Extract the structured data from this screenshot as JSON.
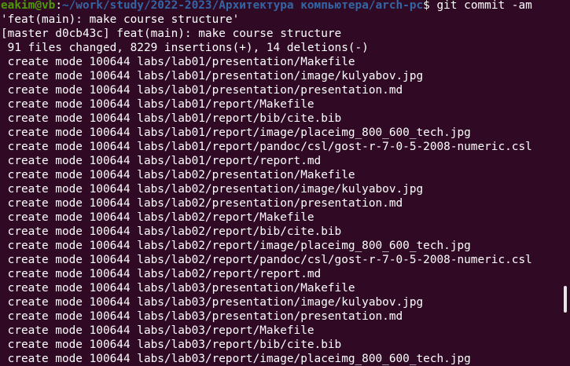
{
  "prompt": {
    "user_host": "eakim@vb",
    "separator": ":",
    "path": "~/work/study/2022-2023/Архитектура компьютера/arch-pc",
    "symbol": "$",
    "command": " git commit -am"
  },
  "output": [
    "'feat(main): make course structure'",
    "[master d0cb43c] feat(main): make course structure",
    " 91 files changed, 8229 insertions(+), 14 deletions(-)",
    " create mode 100644 labs/lab01/presentation/Makefile",
    " create mode 100644 labs/lab01/presentation/image/kulyabov.jpg",
    " create mode 100644 labs/lab01/presentation/presentation.md",
    " create mode 100644 labs/lab01/report/Makefile",
    " create mode 100644 labs/lab01/report/bib/cite.bib",
    " create mode 100644 labs/lab01/report/image/placeimg_800_600_tech.jpg",
    " create mode 100644 labs/lab01/report/pandoc/csl/gost-r-7-0-5-2008-numeric.csl",
    " create mode 100644 labs/lab01/report/report.md",
    " create mode 100644 labs/lab02/presentation/Makefile",
    " create mode 100644 labs/lab02/presentation/image/kulyabov.jpg",
    " create mode 100644 labs/lab02/presentation/presentation.md",
    " create mode 100644 labs/lab02/report/Makefile",
    " create mode 100644 labs/lab02/report/bib/cite.bib",
    " create mode 100644 labs/lab02/report/image/placeimg_800_600_tech.jpg",
    " create mode 100644 labs/lab02/report/pandoc/csl/gost-r-7-0-5-2008-numeric.csl",
    " create mode 100644 labs/lab02/report/report.md",
    " create mode 100644 labs/lab03/presentation/Makefile",
    " create mode 100644 labs/lab03/presentation/image/kulyabov.jpg",
    " create mode 100644 labs/lab03/presentation/presentation.md",
    " create mode 100644 labs/lab03/report/Makefile",
    " create mode 100644 labs/lab03/report/bib/cite.bib",
    " create mode 100644 labs/lab03/report/image/placeimg_800_600_tech.jpg"
  ],
  "colors": {
    "background": "#300a24",
    "text": "#ffffff",
    "user_host": "#4e9a06",
    "path": "#3465a4"
  }
}
